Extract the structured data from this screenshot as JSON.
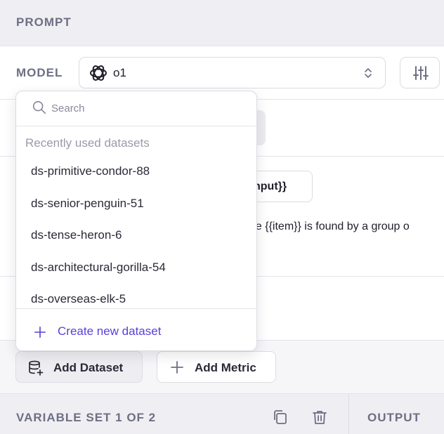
{
  "header": {
    "title": "PROMPT"
  },
  "model": {
    "label": "MODEL",
    "selected": "o1"
  },
  "background": {
    "input_chip": "nput}}",
    "prompt_text": "he {{item}} is found by a group o"
  },
  "dropdown": {
    "search_placeholder": "Search",
    "section_label": "Recently used datasets",
    "items": [
      "ds-primitive-condor-88",
      "ds-senior-penguin-51",
      "ds-tense-heron-6",
      "ds-architectural-gorilla-54",
      "ds-overseas-elk-5"
    ],
    "create_label": "Create new dataset"
  },
  "actions": {
    "add_dataset": "Add Dataset",
    "add_metric": "Add Metric"
  },
  "footer": {
    "variable_set": "VARIABLE SET 1 OF 2",
    "output": "OUTPUT"
  },
  "colors": {
    "accent": "#5a3fd9",
    "muted_label": "#6e6e84",
    "header_bg": "#efeff3"
  }
}
